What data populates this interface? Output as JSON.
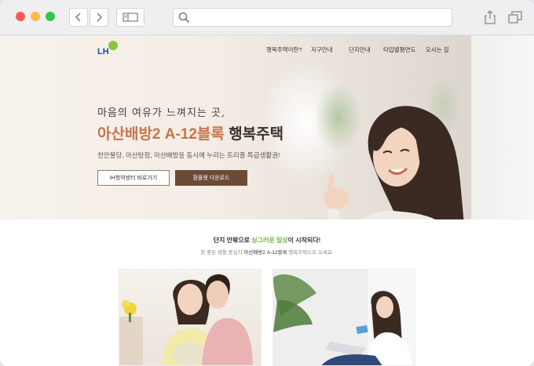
{
  "browser": {
    "icons": [
      "back-icon",
      "forward-icon",
      "sidebar-icon",
      "search-icon",
      "share-icon",
      "tabs-icon"
    ]
  },
  "nav": {
    "logo": "LH",
    "items": [
      "행복주택이란?",
      "지구안내",
      "단지안내",
      "타입별평면도",
      "오시는 길"
    ]
  },
  "hero": {
    "subtitle": "마음의 여유가 느껴지는 곳,",
    "title_accent": "아산배방2 A-12블록",
    "title_rest": " 행복주택",
    "description": "천안불당, 아산탕정, 아산배방을 동시에 누리는 트리플 특급생활권!",
    "button_primary": "IH청약센터 바로가기",
    "button_secondary": "팜플렛 다운로드"
  },
  "section": {
    "title_pre": "단지 안팎으로 ",
    "title_accent": "싱그러운 일상",
    "title_post": "이 시작되다!",
    "sub_pre": "참 좋은 생활 중심지 ",
    "sub_bold": "아산배방2 A-12블록",
    "sub_post": " 행복주택으로 오세요."
  },
  "colors": {
    "accent": "#c8744a",
    "brand_brown": "#6b4a38",
    "green": "#7bb33f"
  }
}
